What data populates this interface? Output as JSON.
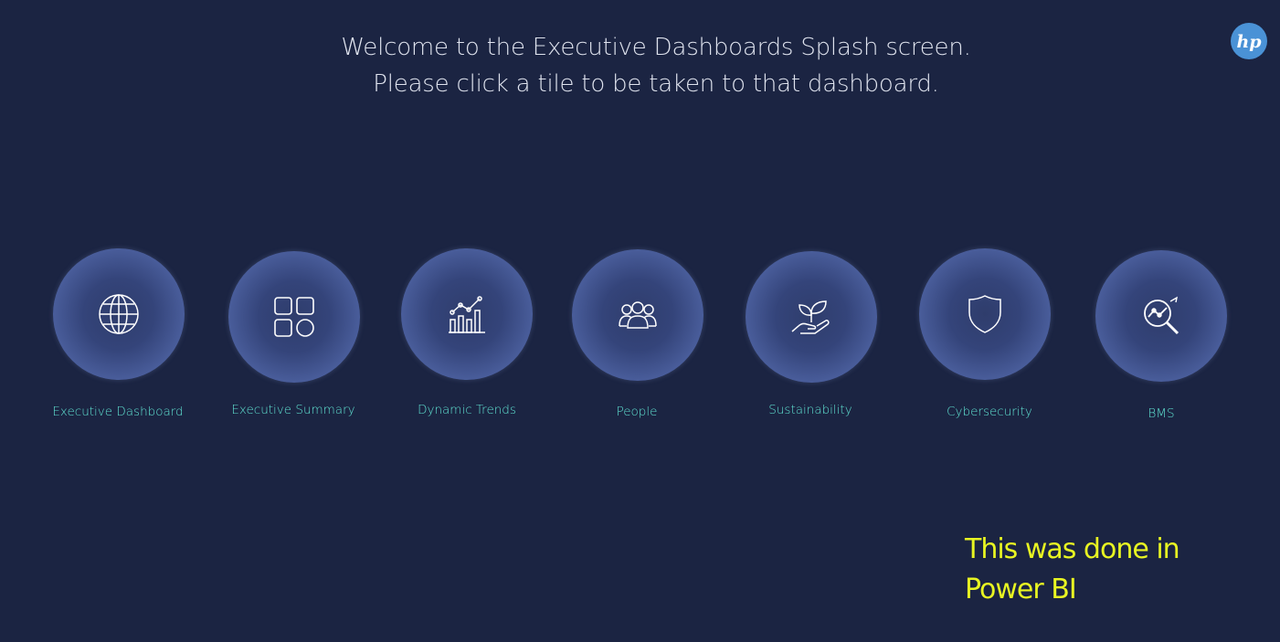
{
  "header": {
    "line1": "Welcome to the Executive Dashboards Splash screen.",
    "line2": "Please click a tile to be taken to that dashboard."
  },
  "logo": {
    "text": "hp",
    "color": "#4a92d6"
  },
  "tiles": [
    {
      "label": "Executive Dashboard",
      "icon": "globe-icon"
    },
    {
      "label": "Executive Summary",
      "icon": "apps-grid-icon"
    },
    {
      "label": "Dynamic Trends",
      "icon": "trend-chart-icon"
    },
    {
      "label": "People",
      "icon": "people-group-icon"
    },
    {
      "label": "Sustainability",
      "icon": "plant-hand-icon"
    },
    {
      "label": "Cybersecurity",
      "icon": "shield-icon"
    },
    {
      "label": "BMS",
      "icon": "magnify-chart-icon"
    }
  ],
  "note": {
    "line1": "This was done in",
    "line2": "Power BI"
  },
  "colors": {
    "background": "#1b2442",
    "label": "#5fe0d0",
    "note": "#e8f522",
    "header_text": "#dfe3ee"
  }
}
